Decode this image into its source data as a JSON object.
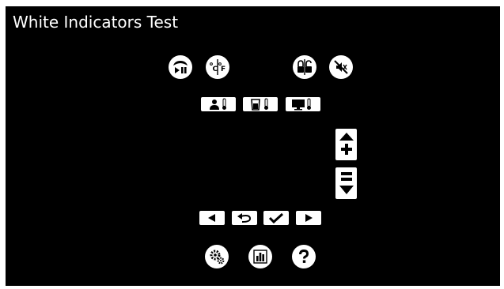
{
  "window": {
    "title": "White Indicators Test"
  },
  "colors": {
    "background": "#000000",
    "foreground": "#ffffff",
    "frame": "#ffffff"
  },
  "icons": {
    "top_row": [
      "play-pause-icon",
      "celsius-fahrenheit-icon",
      "lock-icon",
      "no-sound-icon"
    ],
    "temperature_row": [
      "person-temperature-icon",
      "cup-temperature-icon",
      "monitor-temperature-icon"
    ],
    "adjust": [
      "increase-icon",
      "decrease-icon"
    ],
    "navigation": [
      "previous-icon",
      "back-icon",
      "confirm-icon",
      "next-icon"
    ],
    "bottom_row": [
      "settings-icon",
      "statistics-icon",
      "help-icon"
    ]
  }
}
